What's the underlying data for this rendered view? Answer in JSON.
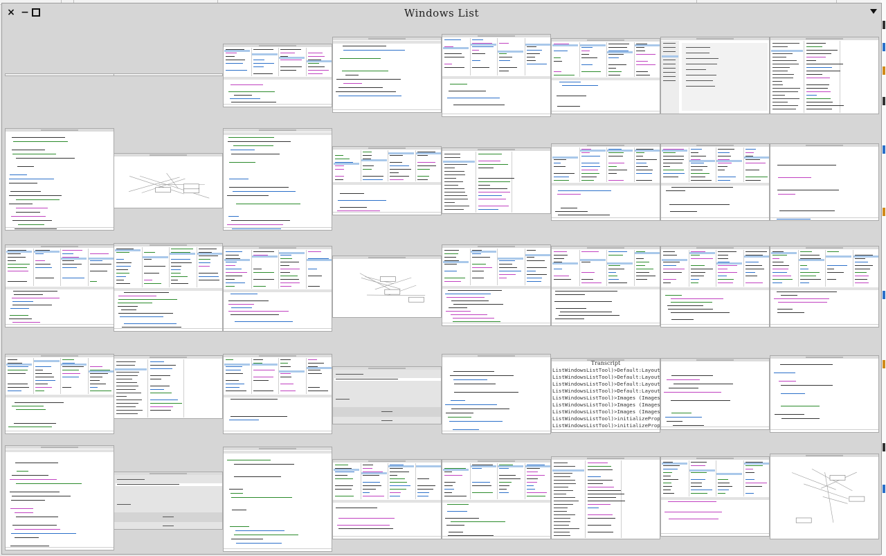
{
  "window": {
    "title": "Windows List",
    "close_glyph": "×",
    "minimize_glyph": "−"
  },
  "thumbnails": {
    "count": 40,
    "r4c5": {
      "title": "Transcript",
      "lines": [
        "ListWindowsListTool)>Default:Layout (Images is Undeclared)",
        "ListWindowsListTool)>Default:Layout (Images is Undeclared)",
        "ListWindowsListTool)>Default:Layout (Images is Undeclared)",
        "ListWindowsListTool)>Default:Layout (Images is Undeclared)",
        "ListWindowsListTool)>Images (Images is Undeclared)",
        "ListWindowsListTool)>Images (Images is Undeclared)",
        "ListWindowsListTool)>Images (Images is Undeclared)",
        "ListWindowsListTool)>initializeProperties (Images is Unde",
        "ListWindowsListTool)>initializeProperties (Images is Undc"
      ]
    }
  },
  "colors": {
    "window_bg": "#d6d6d6",
    "selection": "#a9c8ea",
    "accent_code": "#2a6fc9",
    "accent_string": "#c040c0"
  }
}
